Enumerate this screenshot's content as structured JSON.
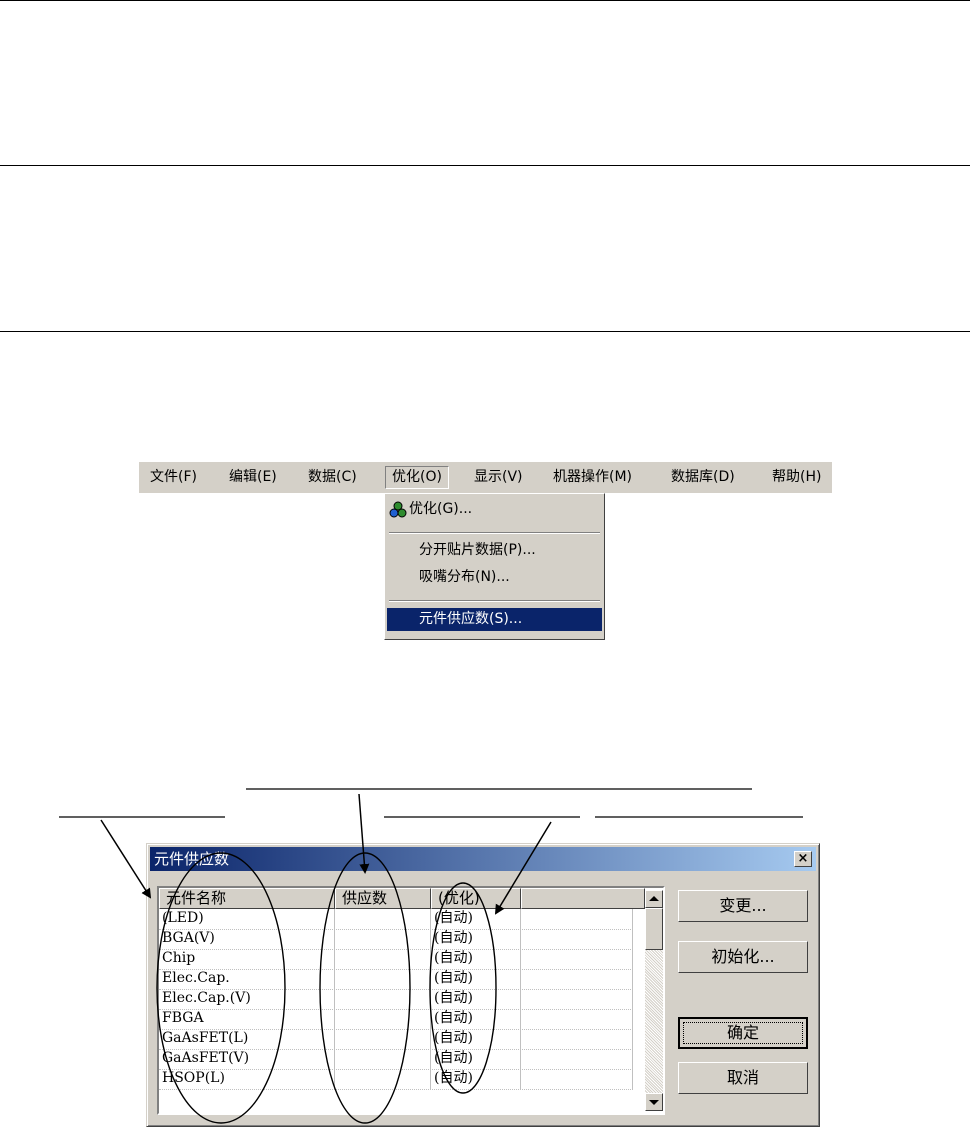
{
  "menubar": {
    "items": [
      {
        "label": "文件(F)"
      },
      {
        "label": "编辑(E)"
      },
      {
        "label": "数据(C)"
      },
      {
        "label": "优化(O)"
      },
      {
        "label": "显示(V)"
      },
      {
        "label": "机器操作(M)"
      },
      {
        "label": "数据库(D)"
      },
      {
        "label": "帮助(H)"
      }
    ]
  },
  "dropdown": {
    "items": [
      {
        "label": "优化(G)...",
        "icon": "optimize-icon"
      },
      {
        "label": "分开贴片数据(P)..."
      },
      {
        "label": "吸嘴分布(N)..."
      },
      {
        "label": "元件供应数(S)..."
      }
    ],
    "selected_index": 3
  },
  "dialog": {
    "title": "元件供应数",
    "close_label": "×",
    "columns": [
      "元件名称",
      "供应数",
      "(优化)",
      ""
    ],
    "rows": [
      {
        "name": "(LED)",
        "supply": "",
        "opt": "(自动)"
      },
      {
        "name": "BGA(V)",
        "supply": "",
        "opt": "(自动)"
      },
      {
        "name": "Chip",
        "supply": "",
        "opt": "(自动)"
      },
      {
        "name": "Elec.Cap.",
        "supply": "",
        "opt": "(自动)"
      },
      {
        "name": "Elec.Cap.(V)",
        "supply": "",
        "opt": "(自动)"
      },
      {
        "name": "FBGA",
        "supply": "",
        "opt": "(自动)"
      },
      {
        "name": "GaAsFET(L)",
        "supply": "",
        "opt": "(自动)"
      },
      {
        "name": "GaAsFET(V)",
        "supply": "",
        "opt": "(自动)"
      },
      {
        "name": "HSOP(L)",
        "supply": "",
        "opt": "(自动)"
      }
    ],
    "buttons": {
      "change": "变更...",
      "init": "初始化...",
      "ok": "确定",
      "cancel": "取消"
    }
  },
  "colors": {
    "face": "#d4d0c8",
    "highlight": "#0a246a",
    "titlebar_end": "#a6caf0"
  }
}
